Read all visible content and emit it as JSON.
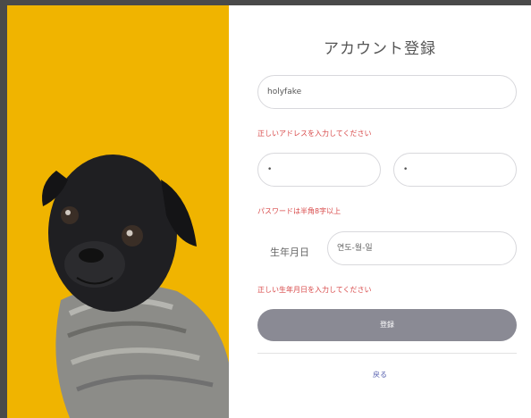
{
  "form": {
    "title": "アカウント登録",
    "email_value": "holyfake",
    "email_error": "正しいアドレスを入力してください",
    "password_value": "•",
    "password_confirm_value": "•",
    "password_error": "パスワードは半角8字以上",
    "dob_label": "生年月日",
    "dob_placeholder": "연도-월-일",
    "dob_error": "正しい生年月日を入力してください",
    "submit_label": "登録",
    "back_label": "戻る"
  },
  "colors": {
    "photo_background": "#f0b400",
    "error": "#d84a4a",
    "button": "#8a8a94",
    "link": "#5a63b0"
  }
}
